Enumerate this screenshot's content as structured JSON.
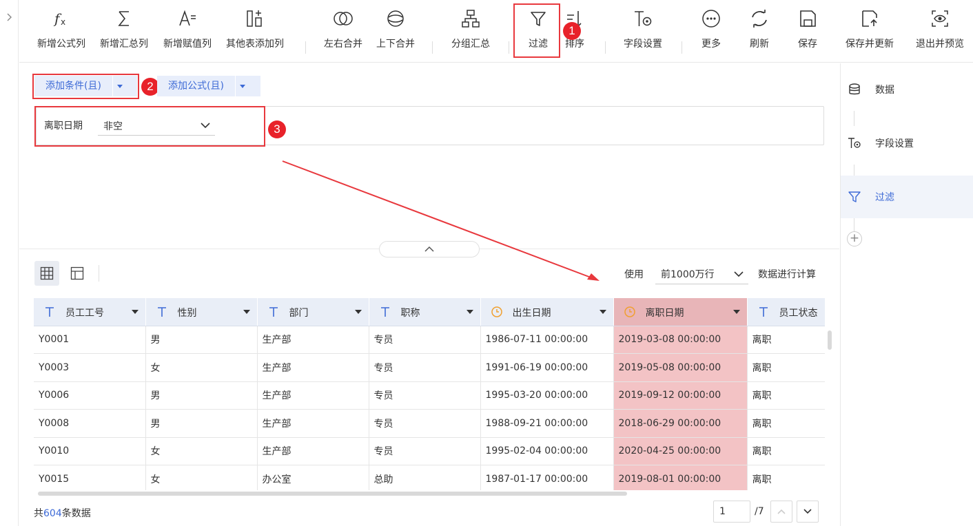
{
  "toolbar": {
    "items": [
      {
        "label": "新增公式列",
        "icon": "fx-icon"
      },
      {
        "label": "新增汇总列",
        "icon": "sigma-icon"
      },
      {
        "label": "新增赋值列",
        "icon": "assign-icon"
      },
      {
        "label": "其他表添加列",
        "icon": "add-column-icon"
      },
      {
        "label": "左右合并",
        "icon": "merge-horizontal-icon"
      },
      {
        "label": "上下合并",
        "icon": "merge-vertical-icon"
      },
      {
        "label": "分组汇总",
        "icon": "group-icon"
      },
      {
        "label": "过滤",
        "icon": "filter-icon"
      },
      {
        "label": "排序",
        "icon": "sort-icon"
      },
      {
        "label": "字段设置",
        "icon": "field-settings-icon"
      },
      {
        "label": "更多",
        "icon": "more-icon"
      },
      {
        "label": "刷新",
        "icon": "refresh-icon"
      },
      {
        "label": "保存",
        "icon": "save-icon"
      },
      {
        "label": "保存并更新",
        "icon": "save-update-icon"
      },
      {
        "label": "退出并预览",
        "icon": "preview-icon"
      }
    ]
  },
  "badges": [
    "1",
    "2",
    "3"
  ],
  "conditions": {
    "add_condition_label": "添加条件(且)",
    "add_formula_label": "添加公式(且)",
    "field_label": "离职日期",
    "operator_value": "非空"
  },
  "right_panel": {
    "items": [
      {
        "label": "数据",
        "icon": "database-icon"
      },
      {
        "label": "字段设置",
        "icon": "field-settings-icon"
      },
      {
        "label": "过滤",
        "icon": "filter-icon",
        "active": true
      }
    ],
    "add_label": "+"
  },
  "data_bar": {
    "use_label": "使用",
    "rows_value": "前1000万行",
    "calc_label": "数据进行计算"
  },
  "table": {
    "columns": [
      {
        "name": "员工工号",
        "type": "text"
      },
      {
        "name": "性别",
        "type": "text"
      },
      {
        "name": "部门",
        "type": "text"
      },
      {
        "name": "职称",
        "type": "text"
      },
      {
        "name": "出生日期",
        "type": "date"
      },
      {
        "name": "离职日期",
        "type": "date",
        "highlight": true
      },
      {
        "name": "员工状态",
        "type": "text"
      }
    ],
    "rows": [
      [
        "Y0001",
        "男",
        "生产部",
        "专员",
        "1986-07-11 00:00:00",
        "2019-03-08 00:00:00",
        "离职"
      ],
      [
        "Y0003",
        "女",
        "生产部",
        "专员",
        "1991-06-19 00:00:00",
        "2019-05-08 00:00:00",
        "离职"
      ],
      [
        "Y0006",
        "男",
        "生产部",
        "专员",
        "1995-03-20 00:00:00",
        "2019-09-12 00:00:00",
        "离职"
      ],
      [
        "Y0008",
        "男",
        "生产部",
        "专员",
        "1988-09-21 00:00:00",
        "2018-06-29 00:00:00",
        "离职"
      ],
      [
        "Y0010",
        "女",
        "生产部",
        "专员",
        "1995-02-04 00:00:00",
        "2020-04-25 00:00:00",
        "离职"
      ],
      [
        "Y0015",
        "女",
        "办公室",
        "总助",
        "1987-01-17 00:00:00",
        "2019-08-01 00:00:00",
        "离职"
      ]
    ]
  },
  "footer": {
    "total_prefix": "共",
    "total_count": "604",
    "total_suffix": "条数据",
    "page_value": "1",
    "page_total": "/7"
  },
  "colors": {
    "accent": "#3d6ad6",
    "highlight_red": "#e8383d",
    "highlight_column": "#f3c3c5"
  }
}
